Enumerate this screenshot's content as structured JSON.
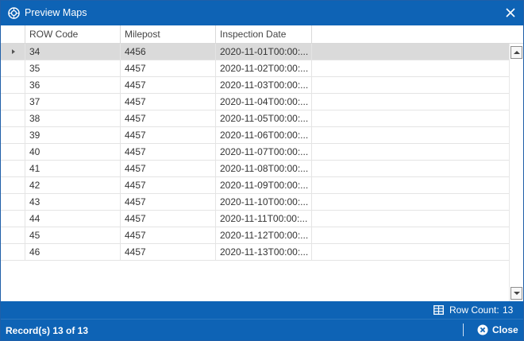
{
  "window": {
    "title": "Preview Maps",
    "title_icon": "map-globe-icon",
    "close_icon": "close-icon"
  },
  "grid": {
    "columns": [
      "ROW Code",
      "Milepost",
      "Inspection Date"
    ],
    "selected_row": 0,
    "rows": [
      {
        "row_code": "34",
        "milepost": "4456",
        "inspection_date": "2020-11-01T00:00:..."
      },
      {
        "row_code": "35",
        "milepost": "4457",
        "inspection_date": "2020-11-02T00:00:..."
      },
      {
        "row_code": "36",
        "milepost": "4457",
        "inspection_date": "2020-11-03T00:00:..."
      },
      {
        "row_code": "37",
        "milepost": "4457",
        "inspection_date": "2020-11-04T00:00:..."
      },
      {
        "row_code": "38",
        "milepost": "4457",
        "inspection_date": "2020-11-05T00:00:..."
      },
      {
        "row_code": "39",
        "milepost": "4457",
        "inspection_date": "2020-11-06T00:00:..."
      },
      {
        "row_code": "40",
        "milepost": "4457",
        "inspection_date": "2020-11-07T00:00:..."
      },
      {
        "row_code": "41",
        "milepost": "4457",
        "inspection_date": "2020-11-08T00:00:..."
      },
      {
        "row_code": "42",
        "milepost": "4457",
        "inspection_date": "2020-11-09T00:00:..."
      },
      {
        "row_code": "43",
        "milepost": "4457",
        "inspection_date": "2020-11-10T00:00:..."
      },
      {
        "row_code": "44",
        "milepost": "4457",
        "inspection_date": "2020-11-11T00:00:..."
      },
      {
        "row_code": "45",
        "milepost": "4457",
        "inspection_date": "2020-11-12T00:00:..."
      },
      {
        "row_code": "46",
        "milepost": "4457",
        "inspection_date": "2020-11-13T00:00:..."
      }
    ]
  },
  "footer": {
    "row_count_label": "Row Count:",
    "row_count_value": "13",
    "row_count_icon": "table-grid-icon"
  },
  "status": {
    "records_text": "Record(s) 13 of 13",
    "close_label": "Close",
    "close_icon": "close-circle-icon"
  },
  "colors": {
    "accent": "#0e63b5",
    "selected_row": "#dadada"
  }
}
